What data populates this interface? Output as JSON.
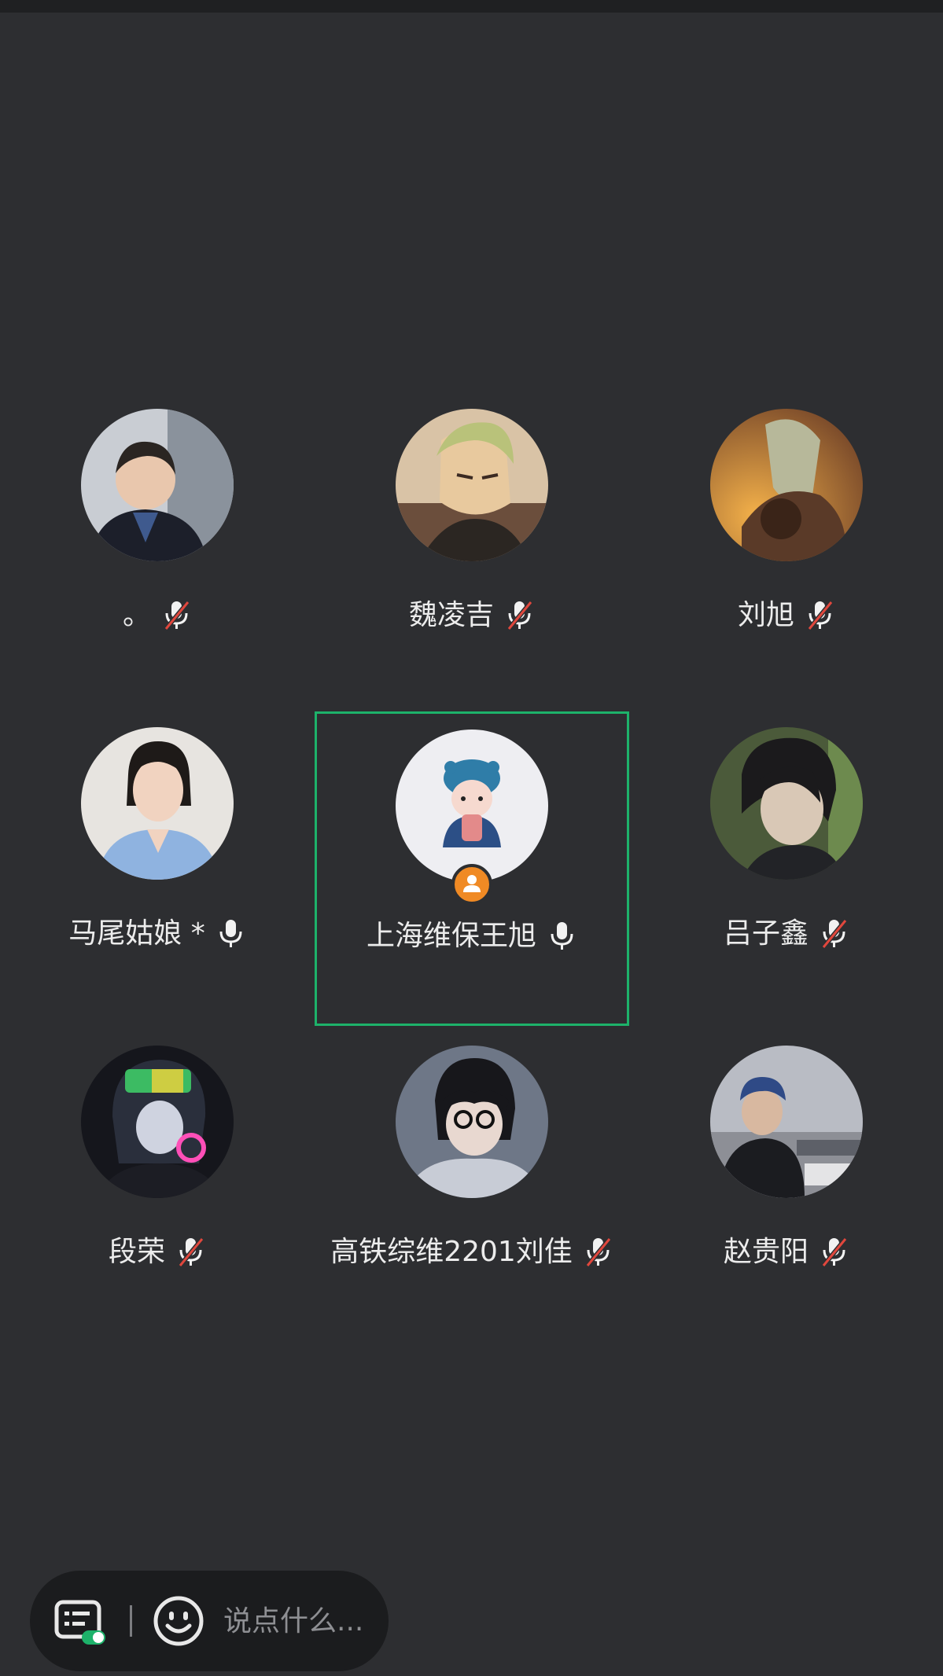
{
  "participants": [
    {
      "name": "。",
      "mic": "muted"
    },
    {
      "name": "魏凌吉",
      "mic": "muted"
    },
    {
      "name": "刘旭",
      "mic": "muted"
    },
    {
      "name": "马尾姑娘 *",
      "mic": "on"
    },
    {
      "name": "上海维保王旭",
      "mic": "on",
      "speaking": true,
      "host": true
    },
    {
      "name": "吕子鑫",
      "mic": "muted"
    },
    {
      "name": "段荣",
      "mic": "muted"
    },
    {
      "name": "高铁综维2201刘佳",
      "mic": "muted"
    },
    {
      "name": "赵贵阳",
      "mic": "muted"
    }
  ],
  "chat_bar": {
    "placeholder": "说点什么..."
  },
  "colors": {
    "background": "#2d2e31",
    "speaking_border": "#1db26a",
    "host_badge": "#f08a24",
    "mute_slash": "#e0473d"
  },
  "icons": {
    "mic_on": "microphone-icon",
    "mic_muted": "microphone-muted-icon",
    "host": "host-person-icon",
    "chat": "chat-list-icon",
    "emoji": "emoji-smile-icon"
  }
}
